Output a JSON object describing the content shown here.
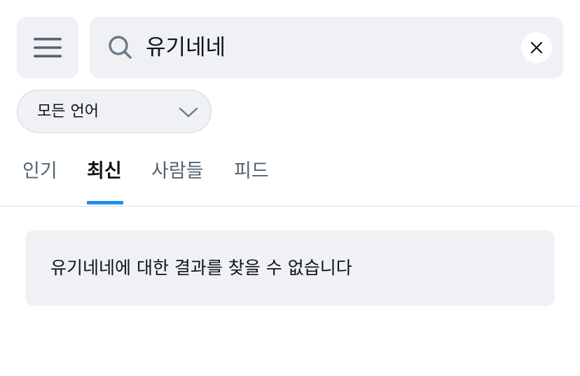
{
  "header": {
    "menu_icon": "hamburger-menu-icon",
    "search": {
      "icon": "search-icon",
      "value": "유기네네",
      "clear_icon": "close-icon"
    }
  },
  "filter": {
    "language": {
      "selected": "모든 언어",
      "icon": "chevron-down-icon"
    }
  },
  "tabs": [
    {
      "label": "인기",
      "active": false
    },
    {
      "label": "최신",
      "active": true
    },
    {
      "label": "사람들",
      "active": false
    },
    {
      "label": "피드",
      "active": false
    }
  ],
  "results": {
    "empty_message": "유기네네에 대한 결과를 찾을 수 없습니다"
  },
  "colors": {
    "accent": "#1d8cf0",
    "surface": "#eff1f4",
    "text_primary": "#0f1419",
    "text_secondary": "#536471"
  }
}
